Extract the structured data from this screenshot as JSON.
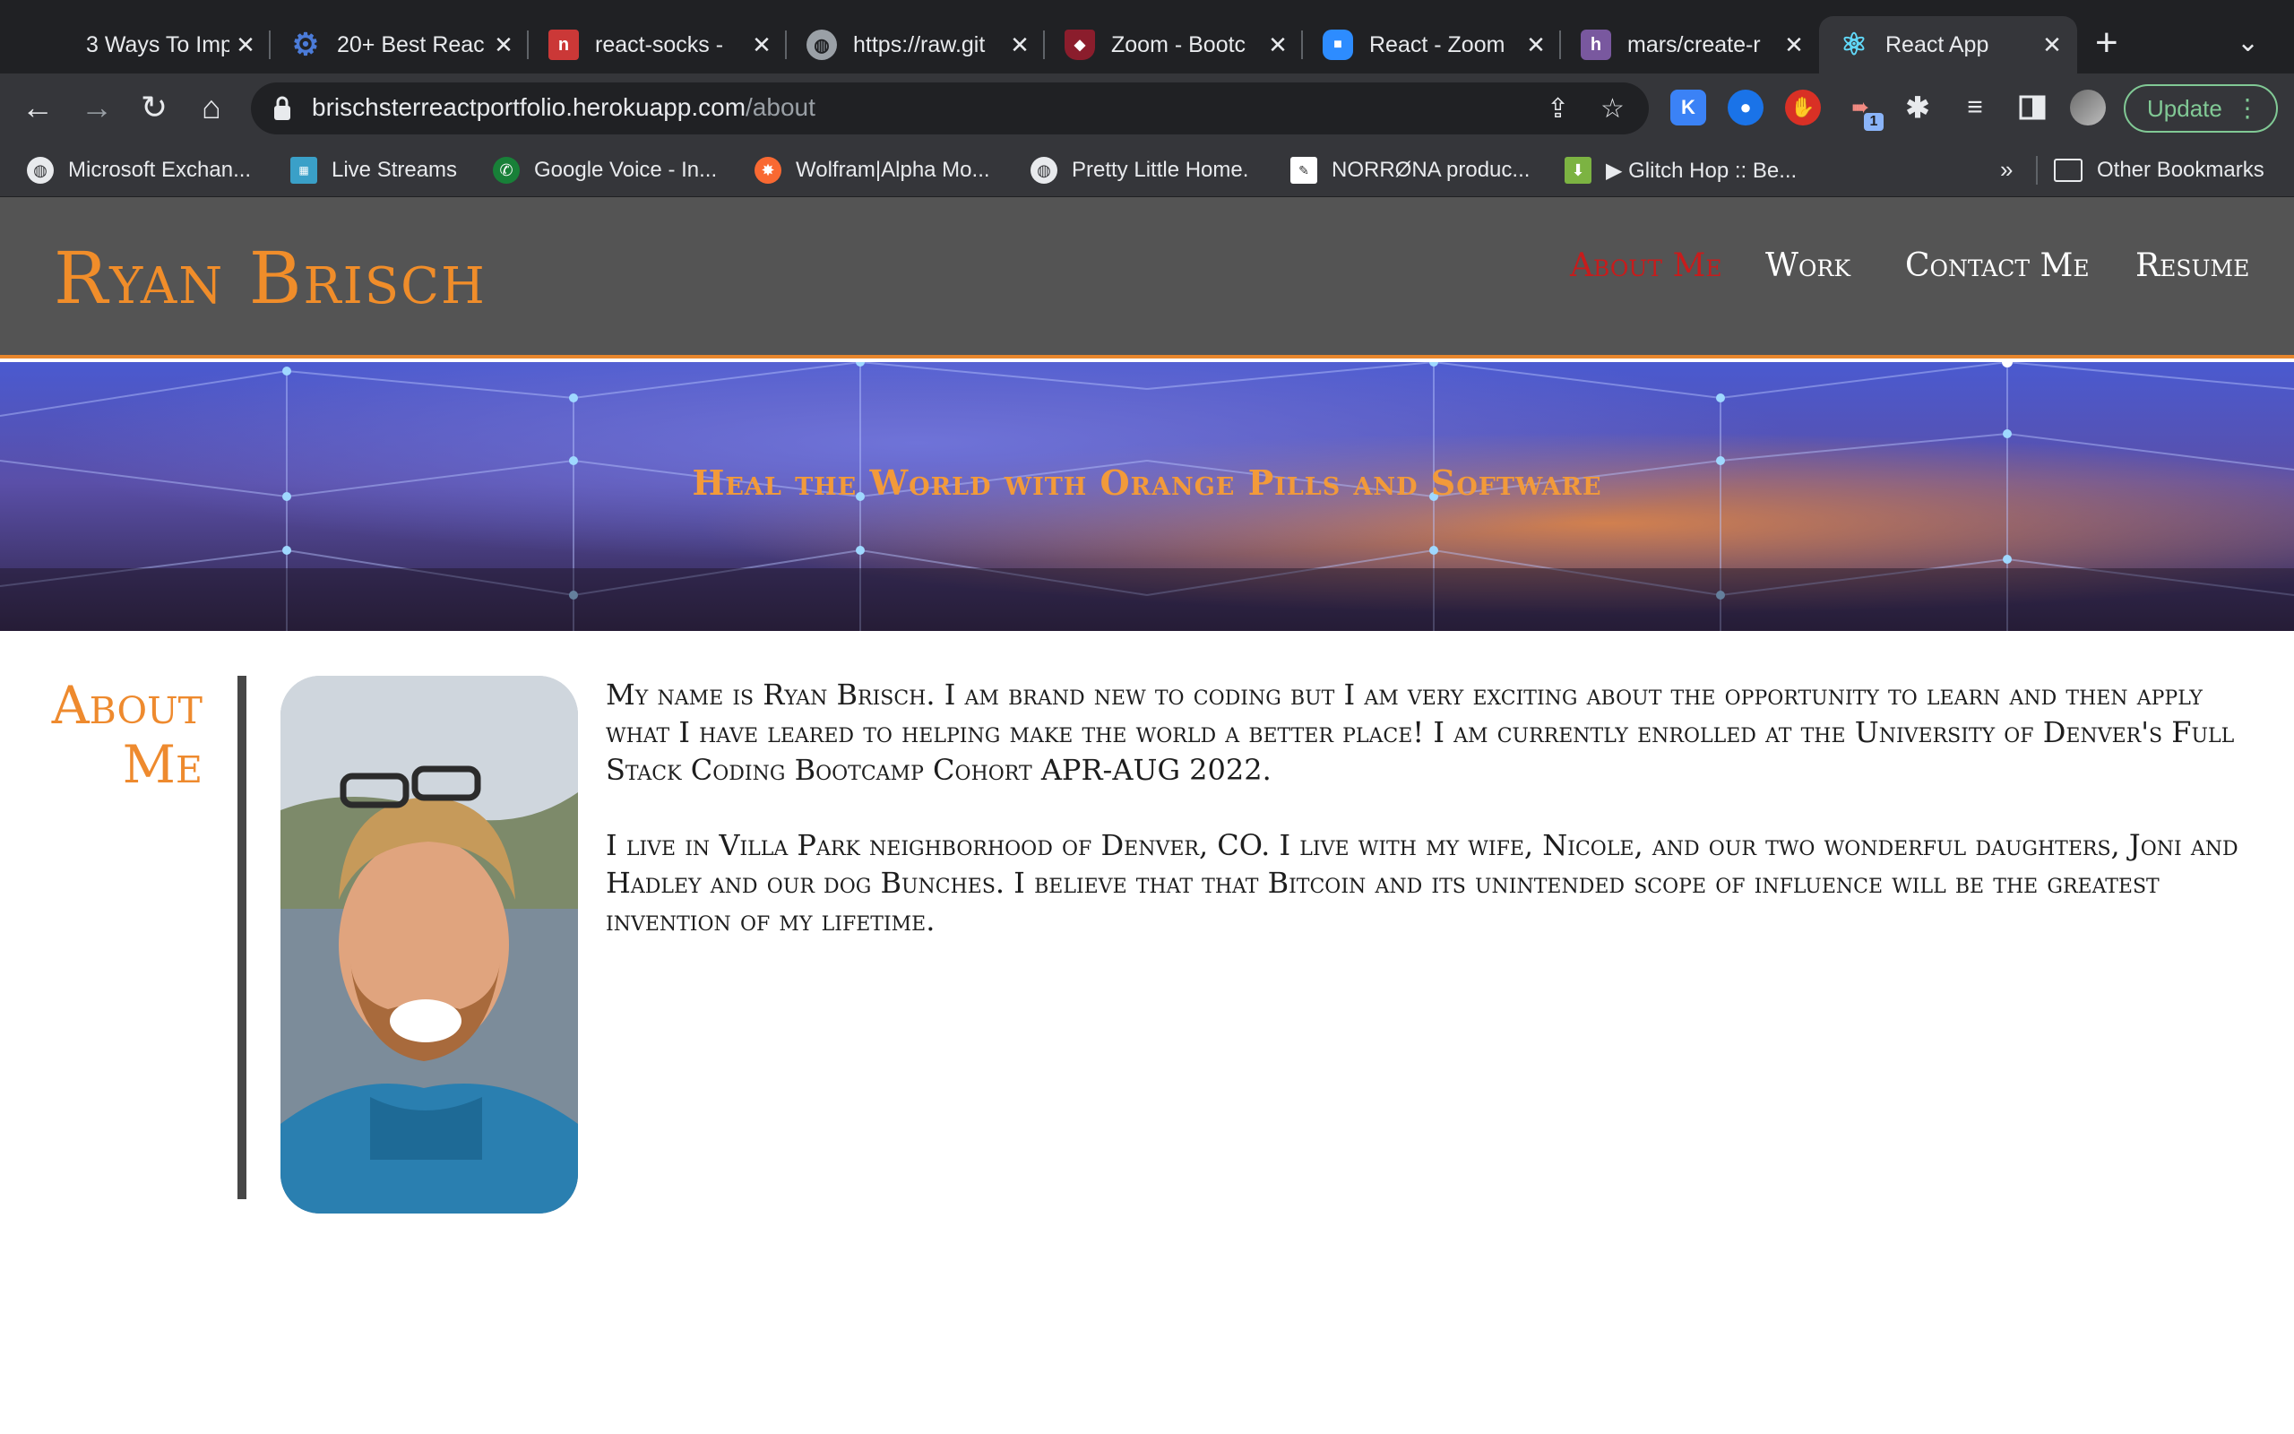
{
  "browser": {
    "tabs": [
      {
        "title": "3 Ways To Imp",
        "icon": "blank-tab-icon",
        "active": false
      },
      {
        "title": "20+ Best Reac",
        "icon": "gear-icon",
        "active": false
      },
      {
        "title": "react-socks -",
        "icon": "npm-icon",
        "active": false
      },
      {
        "title": "https://raw.git",
        "icon": "globe-icon",
        "active": false
      },
      {
        "title": "Zoom - Bootc",
        "icon": "shield-icon",
        "active": false
      },
      {
        "title": "React - Zoom",
        "icon": "zoom-icon",
        "active": false
      },
      {
        "title": "mars/create-r",
        "icon": "heroku-icon",
        "active": false
      },
      {
        "title": "React App",
        "icon": "react-icon",
        "active": true
      }
    ],
    "url_host": "brischsterreactportfolio.herokuapp.com",
    "url_path": "/about",
    "update_label": "Update",
    "extension_badge": "1",
    "bookmarks": [
      {
        "label": "Microsoft Exchan...",
        "icon": "globe-icon"
      },
      {
        "label": "Live Streams",
        "icon": "stream-icon"
      },
      {
        "label": "Google Voice - In...",
        "icon": "phone-icon"
      },
      {
        "label": "Wolfram|Alpha Mo...",
        "icon": "wolfram-icon"
      },
      {
        "label": "Pretty Little Home.",
        "icon": "globe-icon"
      },
      {
        "label": "NORRØNA produc...",
        "icon": "norrona-icon"
      },
      {
        "label": "▶ Glitch Hop :: Be...",
        "icon": "download-icon"
      }
    ],
    "bookmarks_more": "»",
    "other_bookmarks": "Other Bookmarks"
  },
  "site": {
    "brand": "Ryan Brisch",
    "nav": [
      {
        "label": "About Me",
        "active": true
      },
      {
        "label": "Work",
        "active": false
      },
      {
        "label": "Contact Me",
        "active": false
      },
      {
        "label": "Resume",
        "active": false
      }
    ],
    "tagline": "Heal the World with Orange Pills and Software",
    "about_title_line1": "About",
    "about_title_line2": "Me",
    "bio": [
      "My name is Ryan Brisch. I am brand new to coding but I am very exciting about the opportunity to learn and then apply what I have leared to helping make the world a better place! I am currently enrolled at the University of Denver's Full Stack Coding Bootcamp Cohort APR-AUG 2022.",
      "I live in Villa Park neighborhood of Denver, CO. I live with my wife, Nicole, and our two wonderful daughters, Joni and Hadley and our dog Bunches. I believe that that Bitcoin and its unintended scope of influence will be the greatest invention of my lifetime."
    ]
  },
  "colors": {
    "accent_orange": "#f08d2a",
    "active_nav_red": "#c71c1c",
    "header_gray": "#545454",
    "update_green": "#81c995"
  }
}
